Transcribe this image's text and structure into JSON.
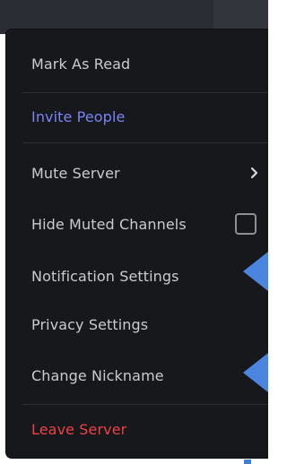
{
  "menu": {
    "items": [
      {
        "label": "Mark As Read",
        "color": "#c9cbcf"
      },
      {
        "label": "Invite People",
        "color": "#7b83f5"
      },
      {
        "label": "Mute Server",
        "color": "#c9cbcf",
        "submenu": true
      },
      {
        "label": "Hide Muted Channels",
        "color": "#c9cbcf",
        "checkbox": false
      },
      {
        "label": "Notification Settings",
        "color": "#c9cbcf"
      },
      {
        "label": "Privacy Settings",
        "color": "#c9cbcf"
      },
      {
        "label": "Change Nickname",
        "color": "#c9cbcf"
      },
      {
        "label": "Leave Server",
        "color": "#ed4245"
      }
    ]
  },
  "annotations": {
    "pointer_color": "#4a86e0"
  },
  "colors": {
    "menu_background": "#17181c",
    "top_bar": "#2a2d33"
  }
}
